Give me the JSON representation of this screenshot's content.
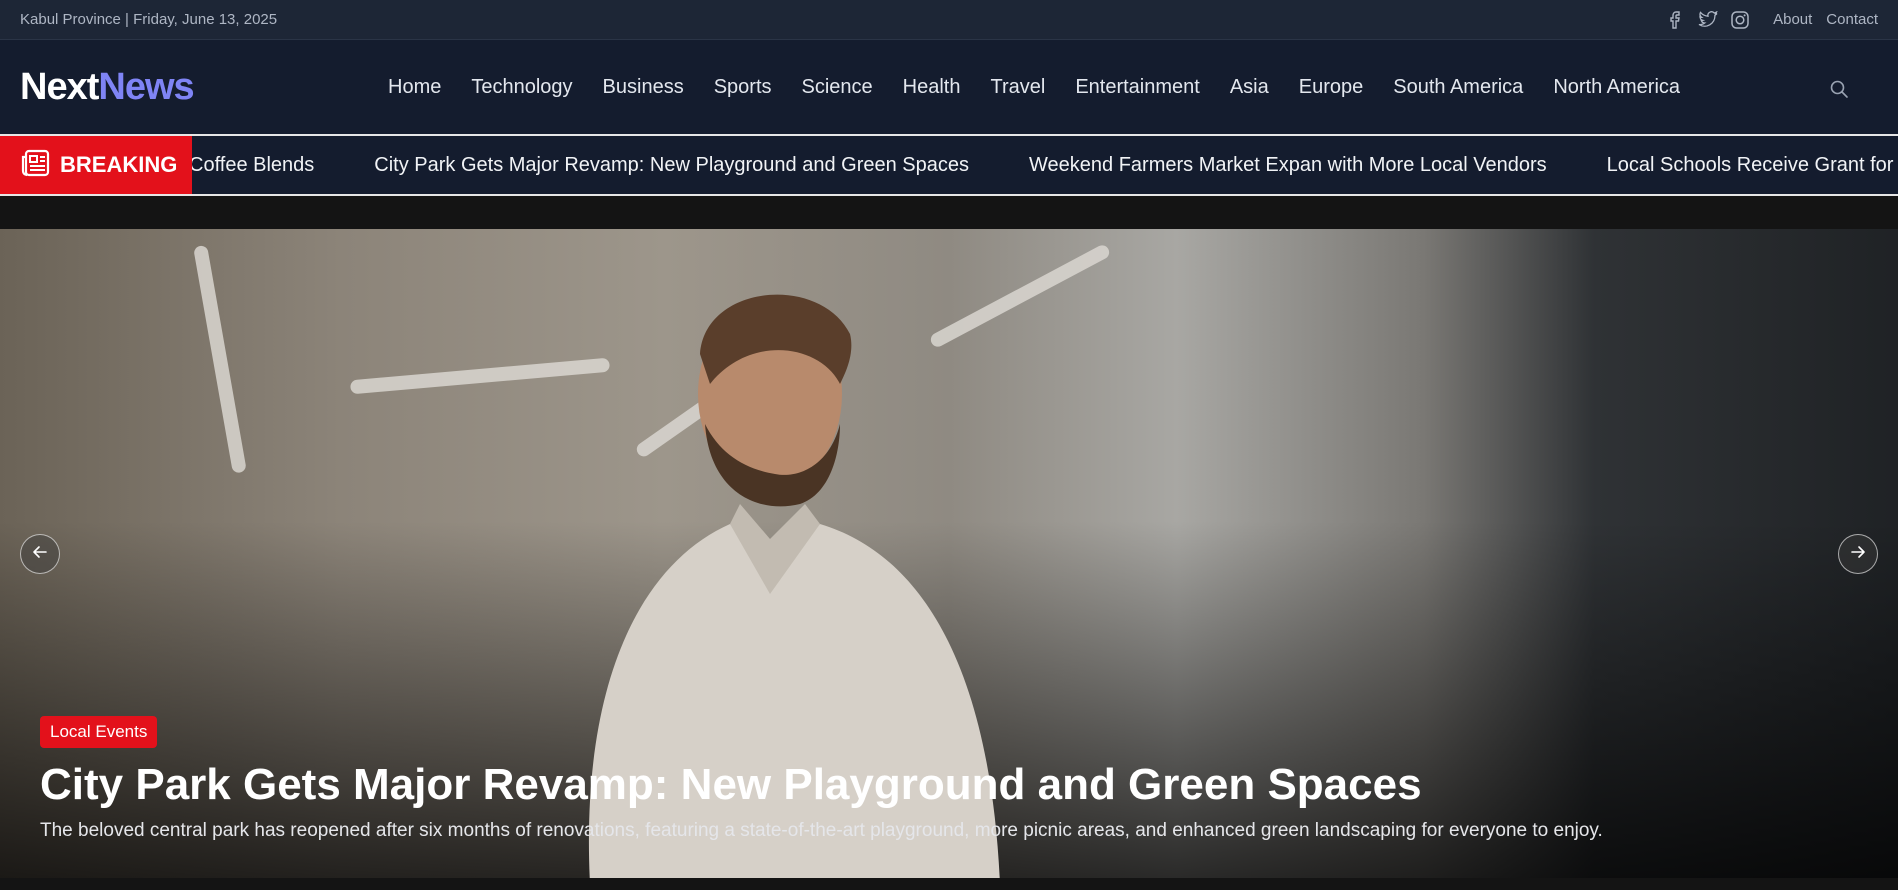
{
  "topbar": {
    "location_date": "Kabul Province | Friday, June 13, 2025",
    "social_icons": [
      "facebook-icon",
      "twitter-icon",
      "instagram-icon"
    ],
    "links": [
      "About",
      "Contact"
    ]
  },
  "header": {
    "logo_part1": "Next",
    "logo_part2": "News",
    "nav": [
      "Home",
      "Technology",
      "Business",
      "Sports",
      "Science",
      "Health",
      "Travel",
      "Entertainment",
      "Asia",
      "Europe",
      "South America",
      "North America"
    ],
    "search_icon": "search-icon"
  },
  "breaking": {
    "label": "BREAKING",
    "icon": "newspaper-icon",
    "items": [
      "Coffee Blends",
      "City Park Gets Major Revamp: New Playground and Green Spaces",
      "Weekend Farmers Market Expan with More Local Vendors",
      "Local Schools Receive Grant for New T"
    ]
  },
  "hero": {
    "category": "Local Events",
    "title": "City Park Gets Major Revamp: New Playground and Green Spaces",
    "summary": "The beloved central park has reopened after six months of renovations, featuring a state-of-the-art playground, more picnic areas, and enhanced green landscaping for everyone to enjoy.",
    "prev_icon": "arrow-left-icon",
    "next_icon": "arrow-right-icon"
  },
  "colors": {
    "accent_red": "#e3111b",
    "logo_blue": "#7f84f5",
    "header_bg": "#141c2e"
  }
}
